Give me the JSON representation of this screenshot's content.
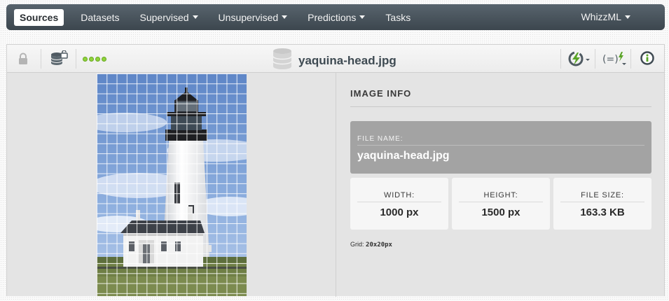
{
  "nav": {
    "items": [
      {
        "label": "Sources",
        "active": true,
        "dropdown": false
      },
      {
        "label": "Datasets",
        "active": false,
        "dropdown": false
      },
      {
        "label": "Supervised",
        "active": false,
        "dropdown": true
      },
      {
        "label": "Unsupervised",
        "active": false,
        "dropdown": true
      },
      {
        "label": "Predictions",
        "active": false,
        "dropdown": true
      },
      {
        "label": "Tasks",
        "active": false,
        "dropdown": false
      }
    ],
    "right_menu": "WhizzML"
  },
  "toolbar": {
    "icons": [
      "lock-icon",
      "database-share-icon",
      "status-dots",
      "flash-configure-icon",
      "formula-flash-icon",
      "info-icon"
    ],
    "status_dot_count": 4,
    "status_color": "#8fd33a",
    "title": "yaquina-head.jpg"
  },
  "image_info": {
    "heading": "IMAGE INFO",
    "file_name_label": "FILE NAME:",
    "file_name": "yaquina-head.jpg",
    "width_label": "WIDTH:",
    "width": "1000 px",
    "height_label": "HEIGHT:",
    "height": "1500 px",
    "file_size_label": "FILE SIZE:",
    "file_size": "163.3 KB",
    "grid_label": "Grid:",
    "grid_value": "20x20px"
  },
  "colors": {
    "nav_bg": "#4a545c",
    "accent_green": "#5aa427",
    "card_gray": "#a3a3a3"
  }
}
